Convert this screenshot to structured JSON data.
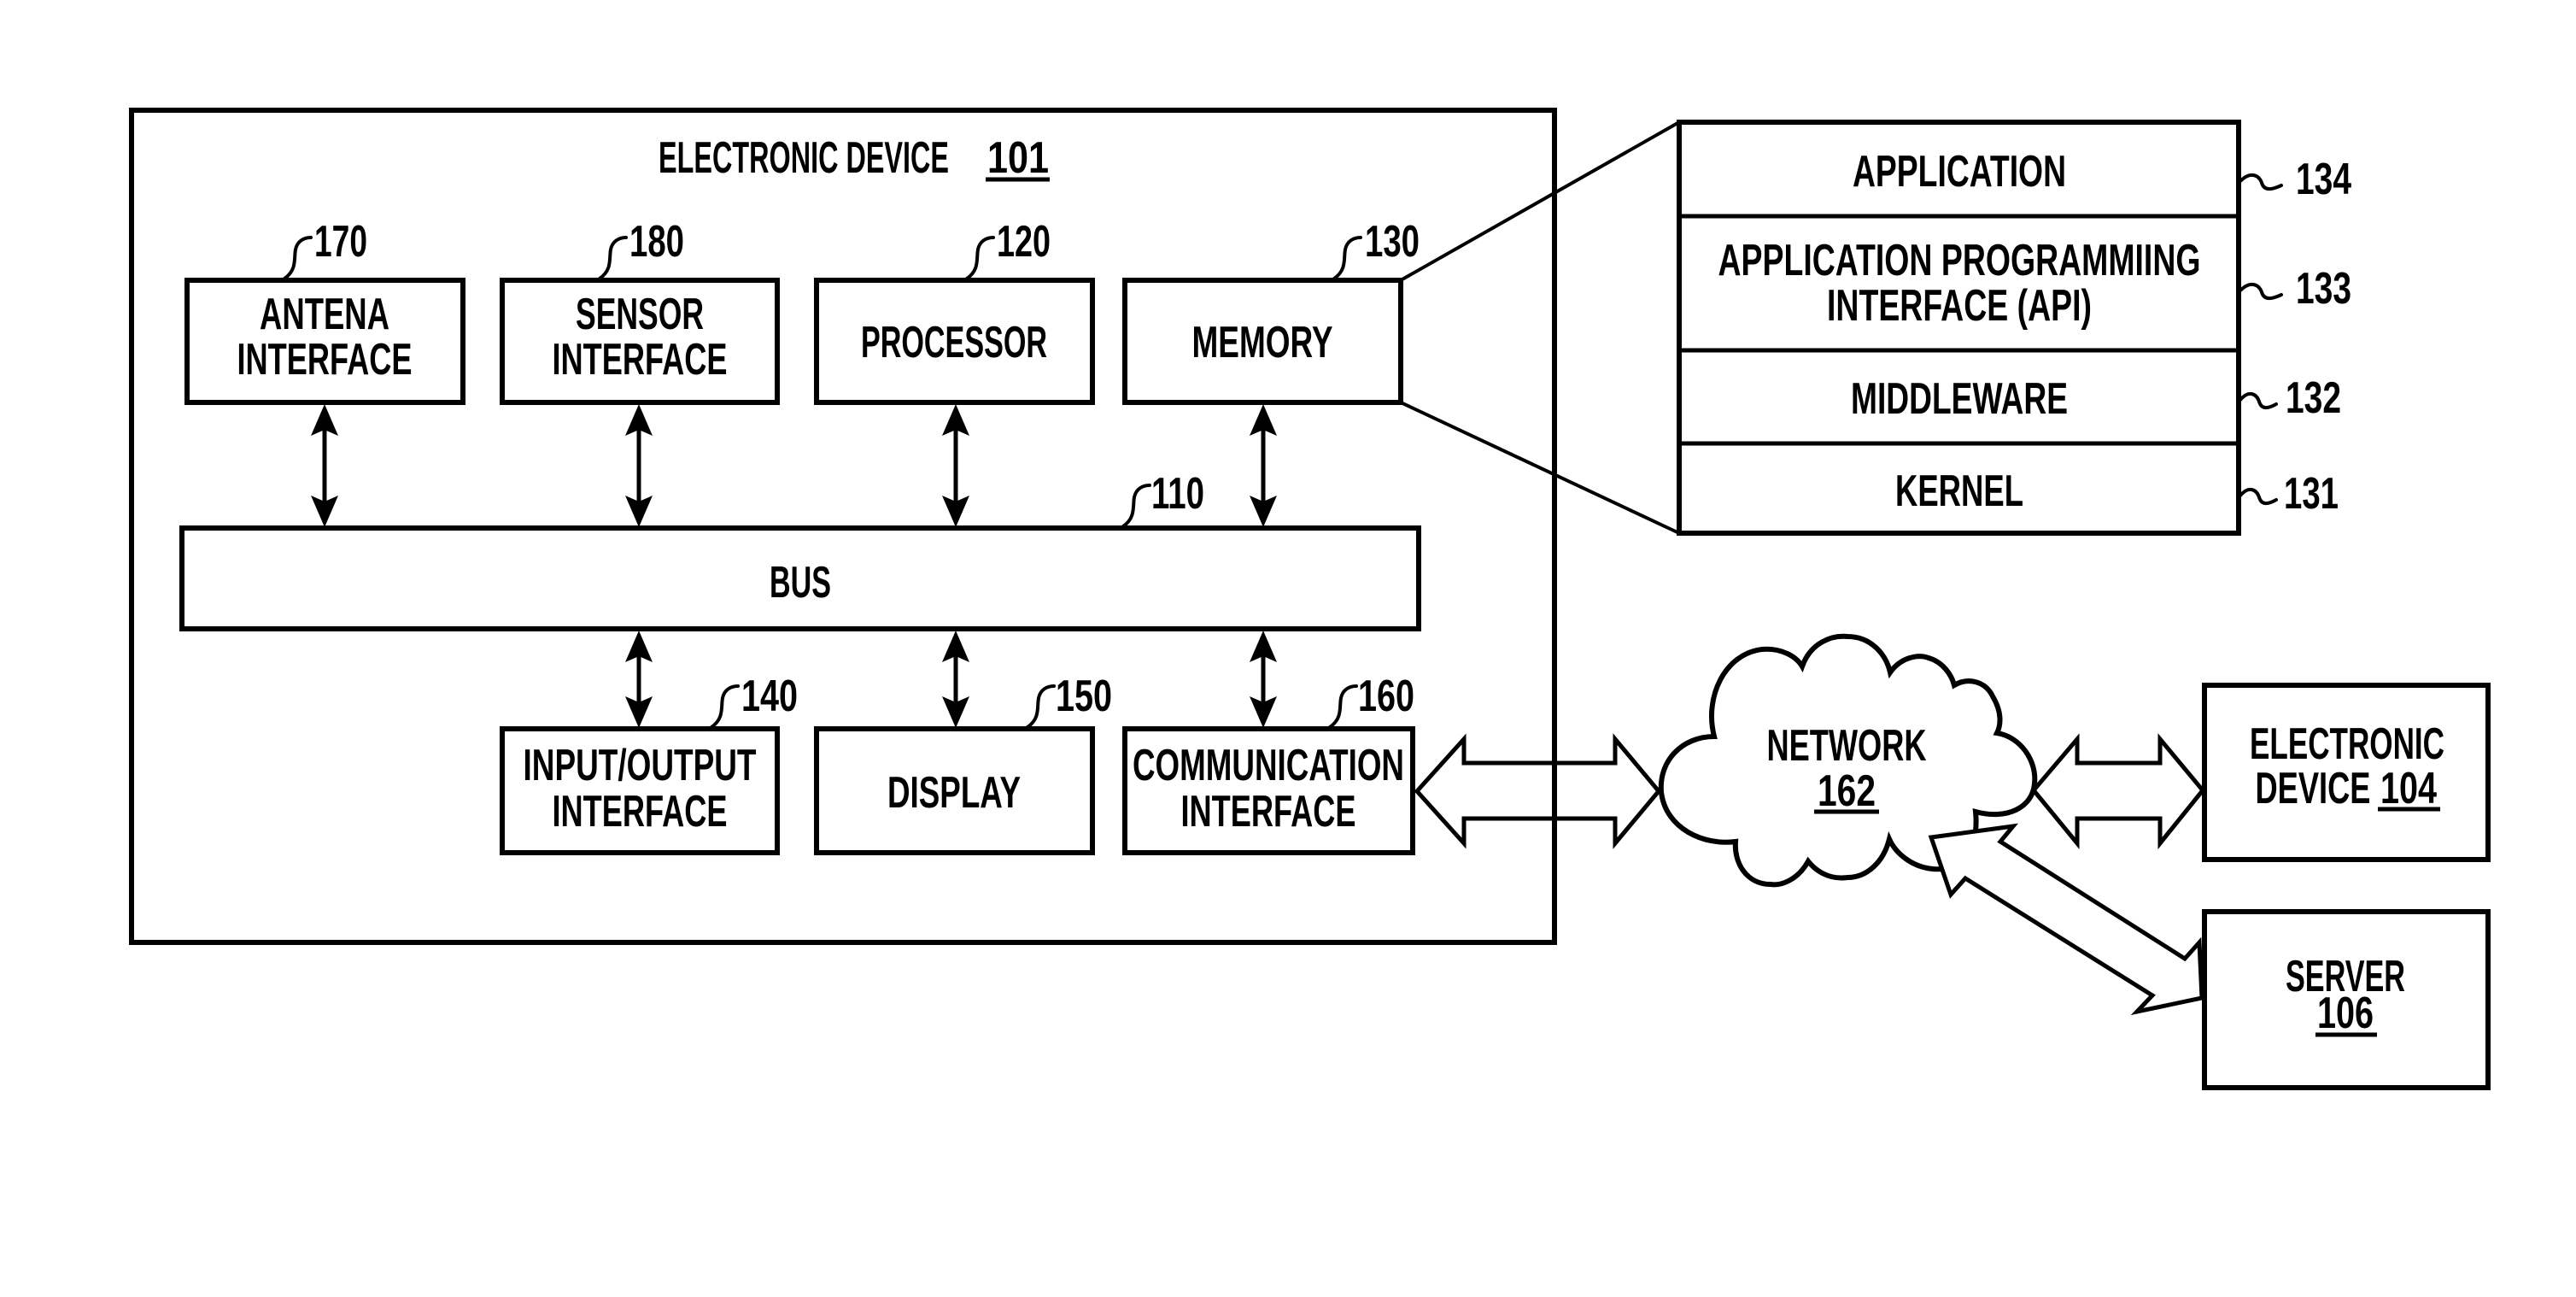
{
  "figure": {
    "main_device": {
      "title": "ELECTRONIC DEVICE",
      "ref": "101"
    },
    "components_top": [
      {
        "id": "antenna",
        "lines": [
          "ANTENA",
          "INTERFACE"
        ],
        "ref": "170"
      },
      {
        "id": "sensor",
        "lines": [
          "SENSOR",
          "INTERFACE"
        ],
        "ref": "180"
      },
      {
        "id": "processor",
        "lines": [
          "PROCESSOR"
        ],
        "ref": "120"
      },
      {
        "id": "memory",
        "lines": [
          "MEMORY"
        ],
        "ref": "130"
      }
    ],
    "bus": {
      "label": "BUS",
      "ref": "110"
    },
    "components_bottom": [
      {
        "id": "io",
        "lines": [
          "INPUT/OUTPUT",
          "INTERFACE"
        ],
        "ref": "140"
      },
      {
        "id": "display",
        "lines": [
          "DISPLAY"
        ],
        "ref": "150"
      },
      {
        "id": "communication",
        "lines": [
          "COMMUNICATION",
          "INTERFACE"
        ],
        "ref": "160"
      }
    ],
    "memory_stack": [
      {
        "id": "application",
        "lines": [
          "APPLICATION"
        ],
        "ref": "134"
      },
      {
        "id": "api",
        "lines": [
          "APPLICATION PROGRAMMIING",
          "INTERFACE (API)"
        ],
        "ref": "133"
      },
      {
        "id": "middleware",
        "lines": [
          "MIDDLEWARE"
        ],
        "ref": "132"
      },
      {
        "id": "kernel",
        "lines": [
          "KERNEL"
        ],
        "ref": "131"
      }
    ],
    "network": {
      "label": "NETWORK",
      "ref": "162"
    },
    "electronic_device_2": {
      "lines": [
        "ELECTRONIC",
        "DEVICE"
      ],
      "ref": "104"
    },
    "server": {
      "label": "SERVER",
      "ref": "106"
    }
  }
}
